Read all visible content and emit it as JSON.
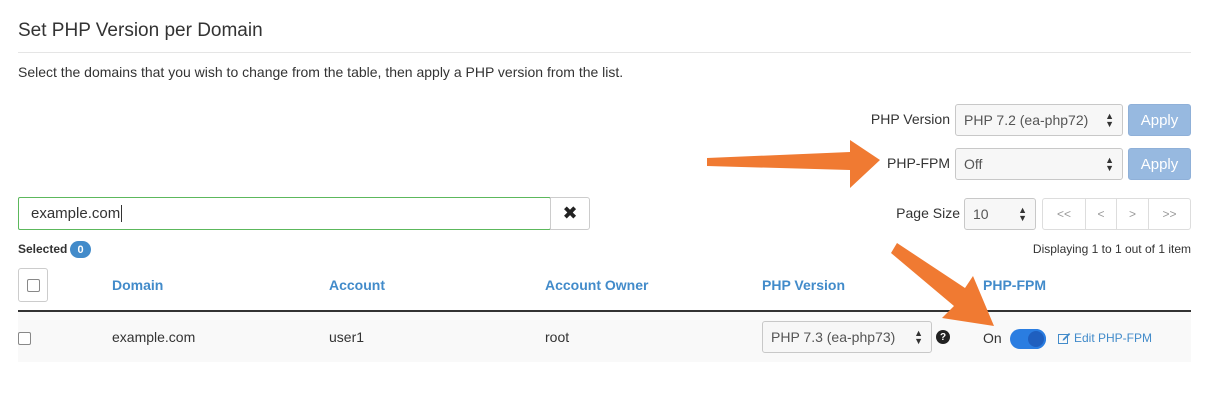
{
  "page": {
    "title": "Set PHP Version per Domain",
    "description": "Select the domains that you wish to change from the table, then apply a PHP version from the list."
  },
  "controls": {
    "php_version_label": "PHP Version",
    "php_version_value": "PHP 7.2 (ea-php72)",
    "php_fpm_label": "PHP-FPM",
    "php_fpm_value": "Off",
    "apply_label": "Apply"
  },
  "search": {
    "value": "example.com",
    "clear_icon": "close-icon"
  },
  "pagination": {
    "page_size_label": "Page Size",
    "page_size_value": "10",
    "first": "<<",
    "prev": "<",
    "next": ">",
    "last": ">>",
    "displaying": "Displaying 1 to 1 out of 1 item"
  },
  "selection": {
    "label": "Selected",
    "count": "0"
  },
  "table": {
    "headers": [
      "Domain",
      "Account",
      "Account Owner",
      "PHP Version",
      "PHP-FPM"
    ],
    "rows": [
      {
        "domain": "example.com",
        "account": "user1",
        "owner": "root",
        "php_version": "PHP 7.3 (ea-php73)",
        "help": "?",
        "fpm_status": "On",
        "fpm_enabled": true,
        "edit_label": "Edit PHP-FPM"
      }
    ]
  },
  "colors": {
    "accent": "#428bca",
    "annotation_arrow": "#f07a32",
    "search_border": "#5cb85c"
  }
}
